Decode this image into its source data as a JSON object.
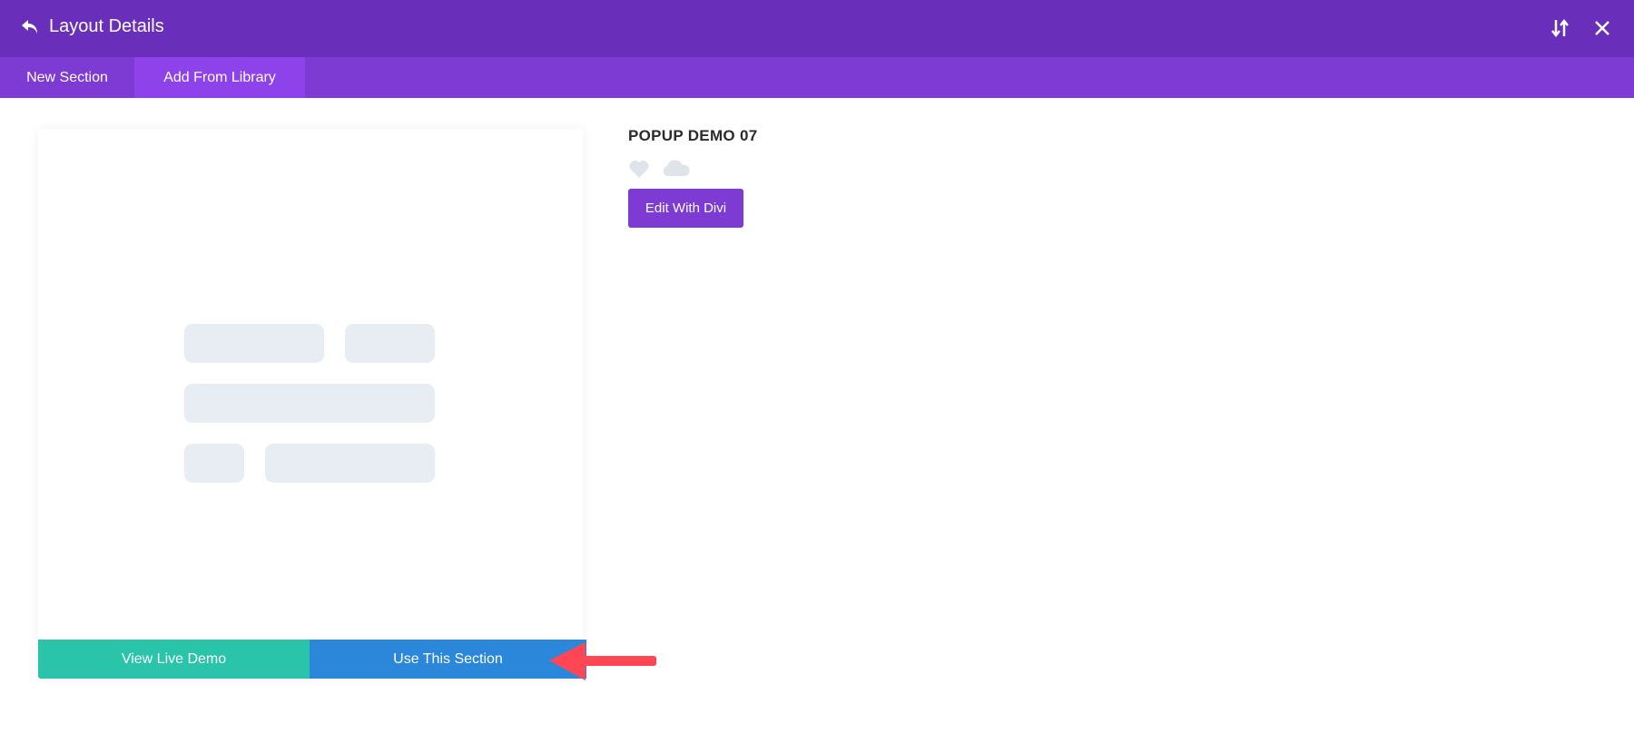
{
  "header": {
    "title": "Layout Details"
  },
  "tabs": [
    {
      "label": "New Section"
    },
    {
      "label": "Add From Library"
    }
  ],
  "preview": {
    "view_demo": "View Live Demo",
    "use_section": "Use This Section"
  },
  "layout": {
    "name": "POPUP DEMO 07",
    "edit_button": "Edit With Divi"
  },
  "colors": {
    "header": "#6a2fba",
    "tabs": "#7d3bd4",
    "active_tab": "#8e43ea",
    "demo": "#29c4a9",
    "use": "#2b87da",
    "arrow": "#ff4655"
  }
}
